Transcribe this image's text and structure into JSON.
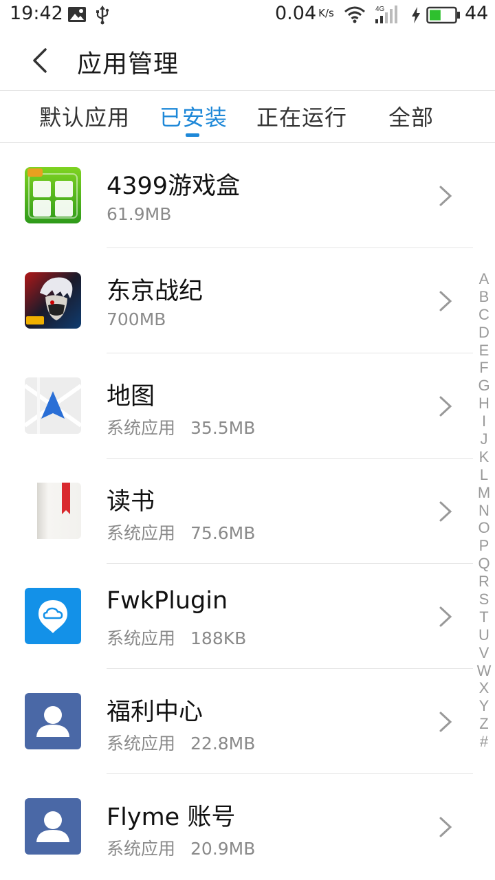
{
  "status_bar": {
    "time": "19:42",
    "left_icons": [
      "image-icon",
      "usb-icon"
    ],
    "net_speed": "0.04",
    "net_speed_unit": "K/s",
    "signal_label": "4G",
    "battery_level": "44",
    "battery_percent": 0.44,
    "battery_color": "#2ec02e"
  },
  "header": {
    "title": "应用管理"
  },
  "tabs": [
    {
      "label": "默认应用",
      "active": false
    },
    {
      "label": "已安装",
      "active": true
    },
    {
      "label": "正在运行",
      "active": false
    },
    {
      "label": "全部",
      "active": false
    }
  ],
  "accent_color": "#1e88d8",
  "apps": [
    {
      "name": "4399游戏盒",
      "tag": "",
      "size": "61.9MB",
      "icon": "4399-game-box-icon"
    },
    {
      "name": "东京战纪",
      "tag": "",
      "size": "700MB",
      "icon": "tokyo-ghoul-game-icon"
    },
    {
      "name": "地图",
      "tag": "系统应用",
      "size": "35.5MB",
      "icon": "map-navigation-icon"
    },
    {
      "name": "读书",
      "tag": "系统应用",
      "size": "75.6MB",
      "icon": "book-bookmark-icon"
    },
    {
      "name": "FwkPlugin",
      "tag": "系统应用",
      "size": "188KB",
      "icon": "cloud-location-icon"
    },
    {
      "name": "福利中心",
      "tag": "系统应用",
      "size": "22.8MB",
      "icon": "user-avatar-icon"
    },
    {
      "name": "Flyme 账号",
      "tag": "系统应用",
      "size": "20.9MB",
      "icon": "user-avatar-icon"
    }
  ],
  "index_letters": [
    "A",
    "B",
    "C",
    "D",
    "E",
    "F",
    "G",
    "H",
    "I",
    "J",
    "K",
    "L",
    "M",
    "N",
    "O",
    "P",
    "Q",
    "R",
    "S",
    "T",
    "U",
    "V",
    "W",
    "X",
    "Y",
    "Z",
    "#"
  ]
}
